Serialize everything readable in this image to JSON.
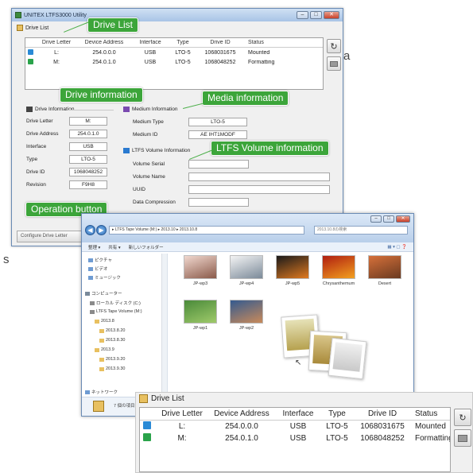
{
  "utility": {
    "title": "UNITEX LTFS3000 Utility",
    "tab_label": "Drive List",
    "columns": [
      "Drive Letter",
      "Device Address",
      "Interface",
      "Type",
      "Drive ID",
      "Status"
    ],
    "rows": [
      {
        "letter": "L:",
        "address": "254.0.0.0",
        "interface": "USB",
        "type": "LTO-5",
        "drive_id": "1068031675",
        "status": "Mounted",
        "icon": "blue"
      },
      {
        "letter": "M:",
        "address": "254.0.1.0",
        "interface": "USB",
        "type": "LTO-5",
        "drive_id": "1068048252",
        "status": "Formatting",
        "icon": "green"
      }
    ],
    "drive_info": {
      "title": "Drive Information",
      "labels": {
        "letter": "Drive Letter",
        "address": "Drive Address",
        "interface": "Interface",
        "type": "Type",
        "id": "Drive ID",
        "revision": "Revision"
      },
      "values": {
        "letter": "M:",
        "address": "254.0.1.0",
        "interface": "USB",
        "type": "LTO-5",
        "id": "1068048252",
        "revision": "F9H8"
      }
    },
    "medium_info": {
      "title": "Medium Information",
      "labels": {
        "type": "Medium Type",
        "id": "Medium ID"
      },
      "values": {
        "type": "LTO-5",
        "id": "AE IHT1MODF"
      }
    },
    "ltfs_info": {
      "title": "LTFS Volume Information",
      "labels": {
        "serial": "Volume Serial",
        "name": "Volume Name",
        "uuid": "UUID",
        "compression": "Data Compression"
      }
    },
    "footer_button": "Configure Drive Letter"
  },
  "callouts": {
    "drive_list": "Drive List",
    "drive_info": "Drive information",
    "media_info": "Media information",
    "ltfs_info": "LTFS Volume information",
    "operation": "Operation button"
  },
  "side_text": {
    "a": "a",
    "s": "s"
  },
  "explorer": {
    "address": "▸ LTFS Tape Volume (M:) ▸ 2013.10 ▸ 2013.10.8",
    "search_placeholder": "2013.10.8の検索",
    "toolbar": [
      "整理 ▾",
      "共有 ▾",
      "新しいフォルダー"
    ],
    "tree": [
      {
        "label": "ピクチャ",
        "color": "#6e9bd2"
      },
      {
        "label": "ビデオ",
        "color": "#6e9bd2"
      },
      {
        "label": "ミュージック",
        "color": "#6e9bd2"
      },
      {
        "label": "コンピューター",
        "color": "#7a8a9a"
      },
      {
        "label": "ローカル ディスク (C:)",
        "color": "#8a8a8a"
      },
      {
        "label": "LTFS Tape Volume (M:)",
        "color": "#8a8a8a"
      },
      {
        "label": "2013.8",
        "color": "#e8c060"
      },
      {
        "label": "2013.8.20",
        "color": "#e8c060"
      },
      {
        "label": "2013.8.30",
        "color": "#e8c060"
      },
      {
        "label": "2013.9",
        "color": "#e8c060"
      },
      {
        "label": "2013.9.20",
        "color": "#e8c060"
      },
      {
        "label": "2013.9.30",
        "color": "#e8c060"
      },
      {
        "label": "ネットワーク",
        "color": "#6e9bd2"
      }
    ],
    "files": [
      {
        "label": "JP-wp3",
        "color1": "#f1d8cf",
        "color2": "#8a5a4a"
      },
      {
        "label": "JP-wp4",
        "color1": "#f4f4f4",
        "color2": "#7b8a99"
      },
      {
        "label": "JP-wp5",
        "color1": "#1a1a1a",
        "color2": "#e07a20"
      },
      {
        "label": "Chrysanthemum",
        "color1": "#b01e10",
        "color2": "#f2a020"
      },
      {
        "label": "Desert",
        "color1": "#d6703a",
        "color2": "#6a3a20"
      },
      {
        "label": "JP-wp1",
        "color1": "#4a8a3a",
        "color2": "#9fca6a"
      },
      {
        "label": "JP-wp2",
        "color1": "#345a8f",
        "color2": "#c98a5a"
      }
    ],
    "status_count": "7 個の項目"
  },
  "zoom": {
    "tab_label": "Drive List",
    "columns": [
      "Drive Letter",
      "Device Address",
      "Interface",
      "Type",
      "Drive ID",
      "Status"
    ],
    "rows": [
      {
        "letter": "L:",
        "address": "254.0.0.0",
        "interface": "USB",
        "type": "LTO-5",
        "drive_id": "1068031675",
        "status": "Mounted",
        "icon": "blue"
      },
      {
        "letter": "M:",
        "address": "254.0.1.0",
        "interface": "USB",
        "type": "LTO-5",
        "drive_id": "1068048252",
        "status": "Formatting",
        "icon": "green"
      }
    ]
  },
  "colors": {
    "callout_green": "#3ca53a",
    "status_blue": "#2a8ad6",
    "status_green": "#2aa34a"
  }
}
